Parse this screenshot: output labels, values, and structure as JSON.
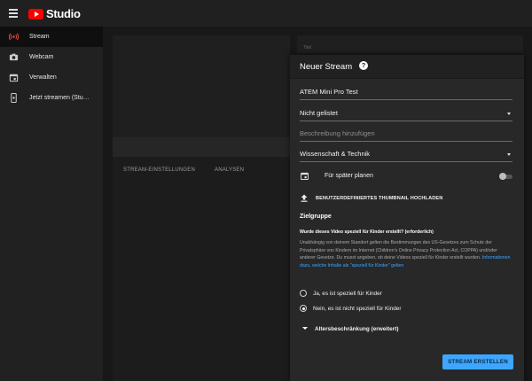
{
  "app": {
    "logo_text": "Studio"
  },
  "sidebar": {
    "items": [
      {
        "label": "Stream",
        "icon": "broadcast-icon",
        "active": true
      },
      {
        "label": "Webcam",
        "icon": "camera-icon",
        "active": false
      },
      {
        "label": "Verwalten",
        "icon": "calendar-icon",
        "active": false
      },
      {
        "label": "Jetzt streamen (Stu…",
        "icon": "phone-stream-icon",
        "active": false
      }
    ]
  },
  "background": {
    "titel_placeholder": "Titel",
    "tabs": [
      "STREAM-EINSTELLUNGEN",
      "ANALYSEN"
    ]
  },
  "dialog": {
    "title": "Neuer Stream",
    "help_icon": "?",
    "title_field": {
      "value": "ATEM Mini Pro Test"
    },
    "visibility_select": {
      "value": "Nicht gelistet"
    },
    "description_field": {
      "placeholder": "Beschreibung hinzufügen"
    },
    "category_select": {
      "value": "Wissenschaft & Technik"
    },
    "schedule": {
      "label": "Für später planen",
      "enabled": false
    },
    "thumbnail": {
      "label": "BENUTZERDEFINIERTES THUMBNAIL HOCHLADEN"
    },
    "audience": {
      "heading": "Zielgruppe",
      "question": "Wurde dieses Video speziell für Kinder erstellt? (erforderlich)",
      "body": "Unabhängig von deinem Standort gelten die Bestimmungen des US-Gesetzes zum Schutz der Privatsphäre von Kindern im Internet (Children's Online Privacy Protection Act, COPPA) und/oder anderer Gesetze. Du musst angeben, ob deine Videos speziell für Kinder erstellt wurden.",
      "link_text": "Informationen dazu, welche Inhalte als \"speziell für Kinder\" gelten",
      "options": [
        {
          "label": "Ja, es ist speziell für Kinder",
          "selected": false
        },
        {
          "label": "Nein, es ist nicht speziell für Kinder",
          "selected": true
        }
      ]
    },
    "age_restriction": {
      "label": "Altersbeschränkung (erweitert)"
    },
    "create_button": {
      "label": "STREAM ERSTELLEN"
    }
  },
  "colors": {
    "accent": "#3ea6ff",
    "logo_red": "#ff0000"
  }
}
